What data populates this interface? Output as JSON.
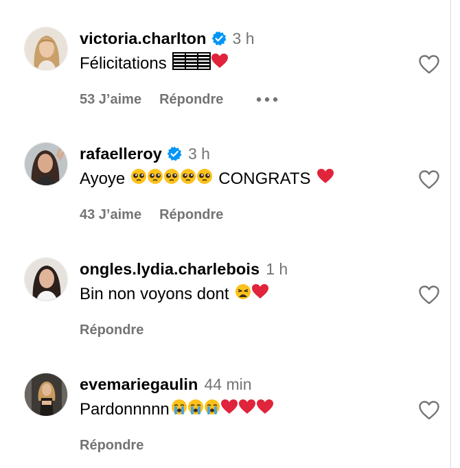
{
  "comments": [
    {
      "username": "victoria.charlton",
      "verified": true,
      "time": "3 h",
      "text": "Félicitations",
      "emojis": [
        "flag-icon",
        "red-heart-icon"
      ],
      "likes": "53 J’aime",
      "reply": "Répondre",
      "has_more": true
    },
    {
      "username": "rafaelleroy",
      "verified": true,
      "time": "3 h",
      "text_before": "Ayoye",
      "emojis_mid": [
        "pleading-face-icon",
        "pleading-face-icon",
        "pleading-face-icon",
        "pleading-face-icon",
        "pleading-face-icon"
      ],
      "text_after": "CONGRATS",
      "emojis_end": [
        "red-heart-icon"
      ],
      "likes": "43 J’aime",
      "reply": "Répondre"
    },
    {
      "username": "ongles.lydia.charlebois",
      "verified": false,
      "time": "1 h",
      "text": "Bin non voyons dont",
      "emojis": [
        "weary-face-icon",
        "red-heart-icon"
      ],
      "reply": "Répondre"
    },
    {
      "username": "evemariegaulin",
      "verified": false,
      "time": "44 min",
      "text": "Pardonnnnn",
      "emojis": [
        "loudly-crying-face-icon",
        "loudly-crying-face-icon",
        "loudly-crying-face-icon",
        "red-heart-icon",
        "red-heart-icon",
        "red-heart-icon"
      ],
      "reply": "Répondre"
    }
  ],
  "colors": {
    "meta_gray": "#737373",
    "verified_blue": "#0095f6",
    "heart_red": "#e0243b"
  }
}
